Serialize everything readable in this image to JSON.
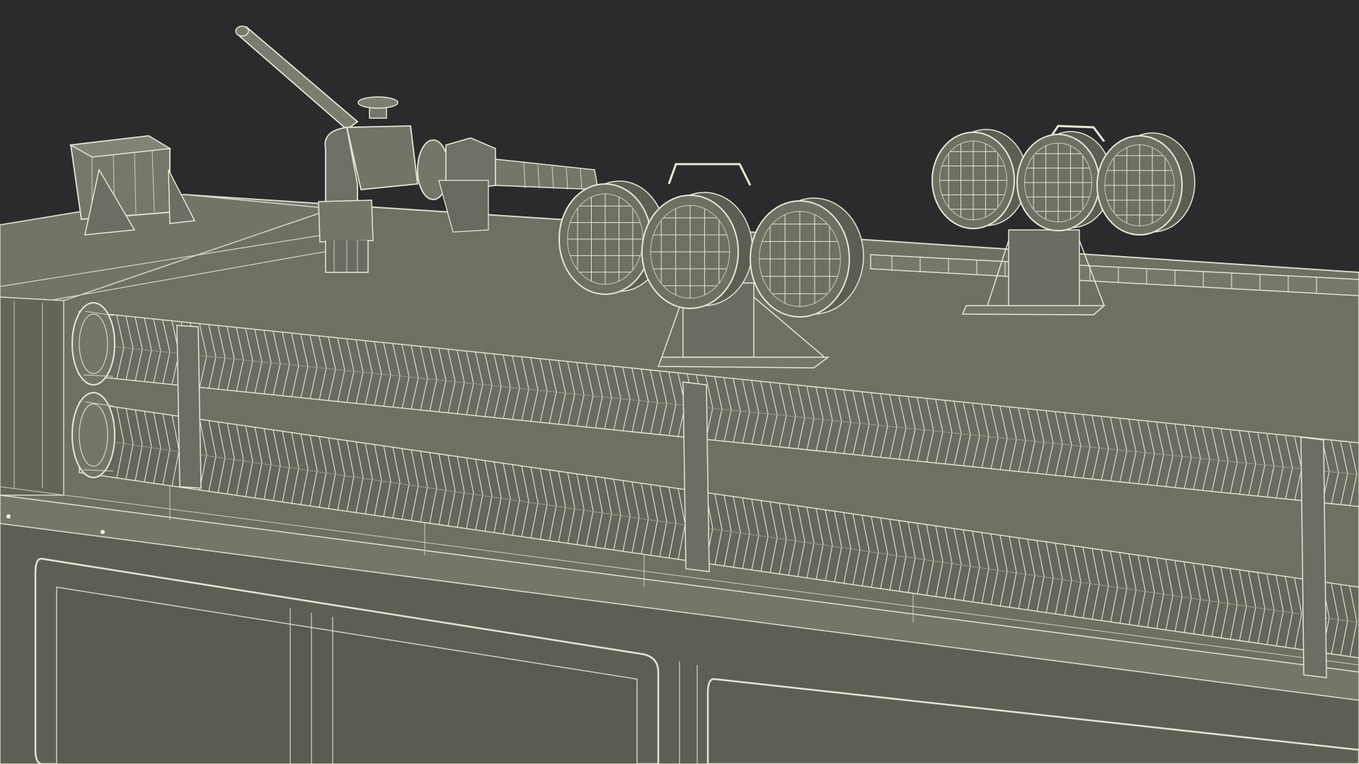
{
  "scene": {
    "subject": "wireframe-3d-model",
    "colors": {
      "background": "#2b2a2c",
      "surface": "#6e7064",
      "surface_dark": "#5c5e54",
      "surface_light": "#7b7d70",
      "wire": "#e6e6d6",
      "wire_dim": "#bdbdae",
      "shadow": "#494a42"
    },
    "components": [
      {
        "name": "roof-deck"
      },
      {
        "name": "front-panel"
      },
      {
        "name": "corrugated-hose",
        "count": 2
      },
      {
        "name": "junction-box"
      },
      {
        "name": "water-cannon"
      },
      {
        "name": "light-cluster",
        "count": 2,
        "lamps_each": 3
      }
    ]
  }
}
